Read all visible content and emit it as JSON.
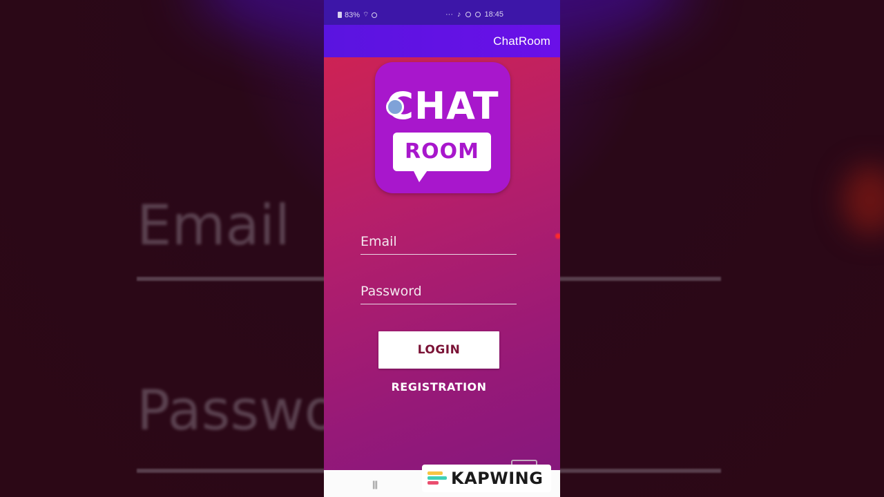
{
  "status_bar": {
    "battery": "83%",
    "time": "18:45",
    "icons": [
      "battery-icon",
      "wifi-icon",
      "alarm-icon",
      "more-icon",
      "notification-icon",
      "whatsapp-icon",
      "messenger-icon"
    ]
  },
  "app_bar": {
    "title": "ChatRoom"
  },
  "logo": {
    "line1": "CHAT",
    "line2": "ROOM"
  },
  "form": {
    "email_placeholder": "Email",
    "password_placeholder": "Password",
    "login_label": "LOGIN",
    "registration_label": "REGISTRATION"
  },
  "nav_bar": {
    "recents_glyph": "|||"
  },
  "background": {
    "email_text": "Email",
    "password_text": "Passwo"
  },
  "watermark": {
    "text": "KAPWING"
  },
  "colors": {
    "status_bar": "#3d16a8",
    "app_bar": "#5a14e0",
    "gradient_top": "#d5244d",
    "gradient_bottom": "#83177e",
    "logo_bg": "#a817cc",
    "login_text": "#7a1235"
  }
}
